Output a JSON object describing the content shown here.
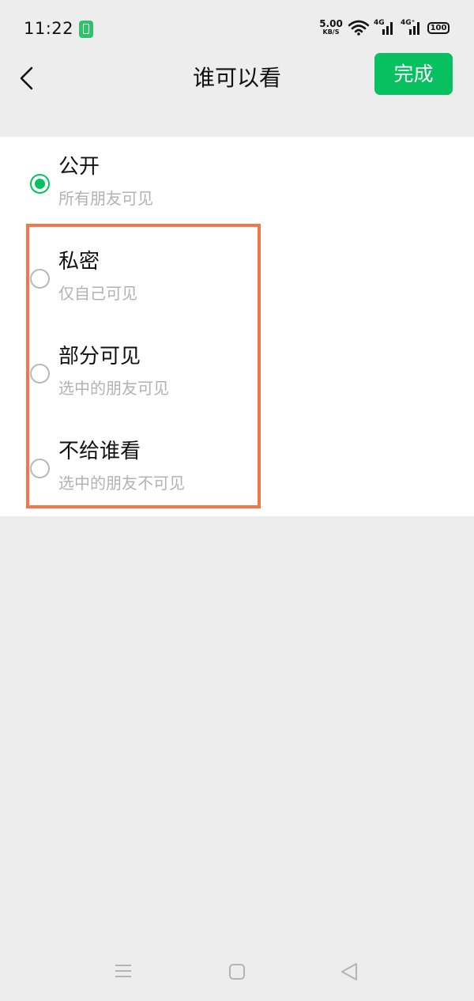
{
  "status_bar": {
    "time": "11:22",
    "net_speed_value": "5.00",
    "net_speed_unit": "KB/S",
    "signal1_label": "4G",
    "signal2_label": "4G⁺",
    "battery_level": "100"
  },
  "nav": {
    "title": "谁可以看",
    "done_label": "完成"
  },
  "options": [
    {
      "label": "公开",
      "desc": "所有朋友可见",
      "selected": true
    },
    {
      "label": "私密",
      "desc": "仅自己可见",
      "selected": false
    },
    {
      "label": "部分可见",
      "desc": "选中的朋友可见",
      "selected": false
    },
    {
      "label": "不给谁看",
      "desc": "选中的朋友不可见",
      "selected": false
    }
  ],
  "colors": {
    "accent": "#07c160",
    "highlight": "#f2764a",
    "background": "#ededed"
  },
  "icons": {
    "back": "chevron-left-icon",
    "system_menu": "menu-icon",
    "system_home": "home-icon",
    "system_back": "triangle-back-icon"
  }
}
